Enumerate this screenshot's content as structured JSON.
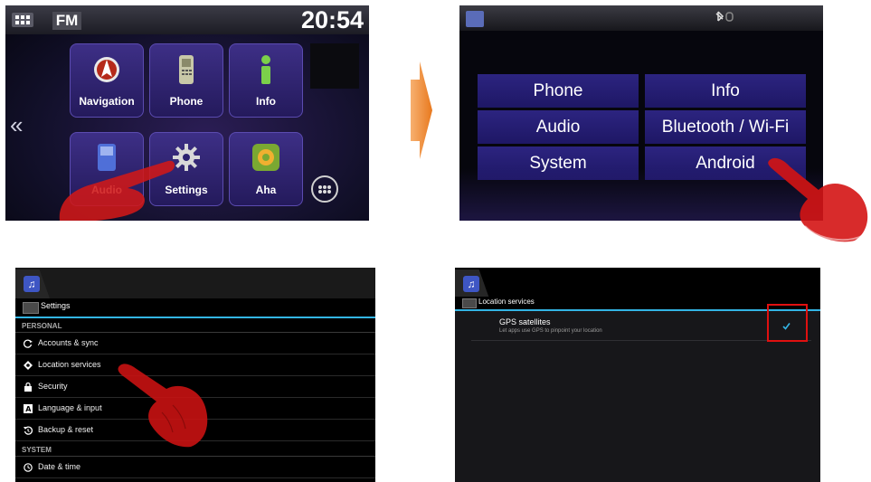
{
  "home": {
    "band": "FM",
    "clock": "20:54",
    "tiles": [
      {
        "label": "Navigation",
        "icon": "navigation-icon"
      },
      {
        "label": "Phone",
        "icon": "phone-icon"
      },
      {
        "label": "Info",
        "icon": "info-icon"
      },
      {
        "label": "Audio",
        "icon": "audio-icon"
      },
      {
        "label": "Settings",
        "icon": "gear-icon"
      },
      {
        "label": "Aha",
        "icon": "aha-icon"
      }
    ],
    "left_chevron": "«",
    "page_dots": 5,
    "active_dot": 5
  },
  "settings_menu": {
    "buttons": [
      {
        "label": "Phone"
      },
      {
        "label": "Info"
      },
      {
        "label": "Audio"
      },
      {
        "label": "Bluetooth / Wi-Fi"
      },
      {
        "label": "System"
      },
      {
        "label": "Android"
      }
    ]
  },
  "android_settings": {
    "header": "Settings",
    "sections": [
      {
        "title": "PERSONAL"
      },
      {
        "title": "SYSTEM"
      }
    ],
    "rows": [
      {
        "label": "Accounts & sync",
        "icon": "sync-icon"
      },
      {
        "label": "Location services",
        "icon": "location-icon"
      },
      {
        "label": "Security",
        "icon": "lock-icon"
      },
      {
        "label": "Language & input",
        "icon": "keyboard-icon"
      },
      {
        "label": "Backup & reset",
        "icon": "backup-icon"
      },
      {
        "label": "Date & time",
        "icon": "clock-icon"
      }
    ]
  },
  "location_services": {
    "header": "Location services",
    "option_title": "GPS satellites",
    "option_subtitle": "Let apps use GPS to pinpoint your location",
    "checked": true
  },
  "colors": {
    "accent": "#33b5e5",
    "highlight": "#e01010",
    "tile": "#2c2480",
    "arrow": "#f08a24"
  }
}
